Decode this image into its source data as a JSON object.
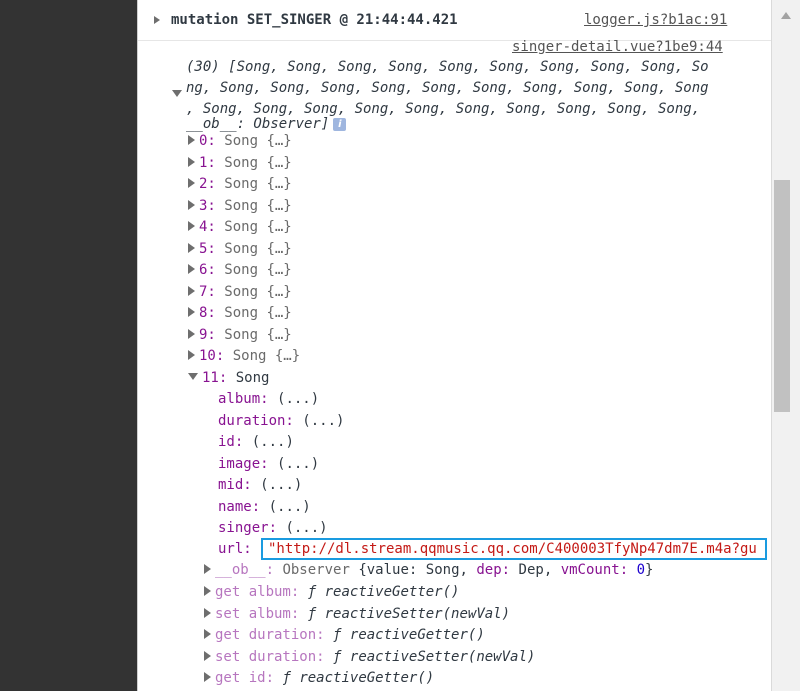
{
  "header": {
    "text": "mutation SET_SINGER @ 21:44:44.421",
    "source": "logger.js?b1ac:91"
  },
  "log_source": "singer-detail.vue?1be9:44",
  "array_summary": [
    "(30) [Song, Song, Song, Song, Song, Song, Song, Song, Song, So",
    "ng, Song, Song, Song, Song, Song, Song, Song, Song, Song, Song",
    ", Song, Song, Song, Song, Song, Song, Song, Song, Song, Song,",
    "__ob__: Observer]"
  ],
  "info_icon_text": "i",
  "collapsed_items": [
    {
      "index": "0:",
      "value": "Song {…}"
    },
    {
      "index": "1:",
      "value": "Song {…}"
    },
    {
      "index": "2:",
      "value": "Song {…}"
    },
    {
      "index": "3:",
      "value": "Song {…}"
    },
    {
      "index": "4:",
      "value": "Song {…}"
    },
    {
      "index": "5:",
      "value": "Song {…}"
    },
    {
      "index": "6:",
      "value": "Song {…}"
    },
    {
      "index": "7:",
      "value": "Song {…}"
    },
    {
      "index": "8:",
      "value": "Song {…}"
    },
    {
      "index": "9:",
      "value": "Song {…}"
    },
    {
      "index": "10:",
      "value": "Song {…}"
    }
  ],
  "expanded_item": {
    "index": "11:",
    "value": "Song"
  },
  "properties": [
    {
      "key": "album:",
      "value": "(...)"
    },
    {
      "key": "duration:",
      "value": "(...)"
    },
    {
      "key": "id:",
      "value": "(...)"
    },
    {
      "key": "image:",
      "value": "(...)"
    },
    {
      "key": "mid:",
      "value": "(...)"
    },
    {
      "key": "name:",
      "value": "(...)"
    },
    {
      "key": "singer:",
      "value": "(...)"
    }
  ],
  "url_property": {
    "key": "url:",
    "value": "\"http://dl.stream.qqmusic.qq.com/C400003TfyNp47dm7E.m4a?gu"
  },
  "observer": {
    "key": "__ob__:",
    "type": "Observer",
    "open": "{value:",
    "value_song": "Song,",
    "dep_key": "dep:",
    "dep_value": "Dep,",
    "vm_key": "vmCount:",
    "vm_value": "0",
    "close": "}"
  },
  "accessors": [
    {
      "key": "get album:",
      "f": "ƒ",
      "fn": "reactiveGetter()"
    },
    {
      "key": "set album:",
      "f": "ƒ",
      "fn": "reactiveSetter(newVal)"
    },
    {
      "key": "get duration:",
      "f": "ƒ",
      "fn": "reactiveGetter()"
    },
    {
      "key": "set duration:",
      "f": "ƒ",
      "fn": "reactiveSetter(newVal)"
    },
    {
      "key": "get id:",
      "f": "ƒ",
      "fn": "reactiveGetter()"
    }
  ]
}
